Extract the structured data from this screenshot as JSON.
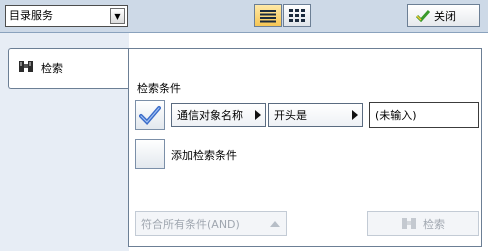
{
  "header": {
    "service_select": {
      "value": "目录服务",
      "icon": "chevron-down-icon"
    },
    "view_list_icon": "list-view-icon",
    "view_grid_icon": "grid-view-icon",
    "close_label": "关闭",
    "close_icon": "check-icon"
  },
  "sidebar": {
    "tabs": [
      {
        "label": "检索",
        "icon": "binoculars-icon",
        "selected": true
      }
    ]
  },
  "main": {
    "section_title": "检索条件",
    "condition": {
      "checked": true,
      "field_label": "通信对象名称",
      "operator_label": "开头是",
      "value": "(未输入)"
    },
    "add_condition_label": "添加检索条件",
    "match_select": "符合所有条件(AND)",
    "search_button": "检索"
  },
  "colors": {
    "topbar_bg": "#cdd9e7",
    "sidebar_bg": "#e7edf5",
    "highlight": "#f6c654",
    "checkmark": "#3b6cc9",
    "disabled_text": "#a0a7b0"
  }
}
